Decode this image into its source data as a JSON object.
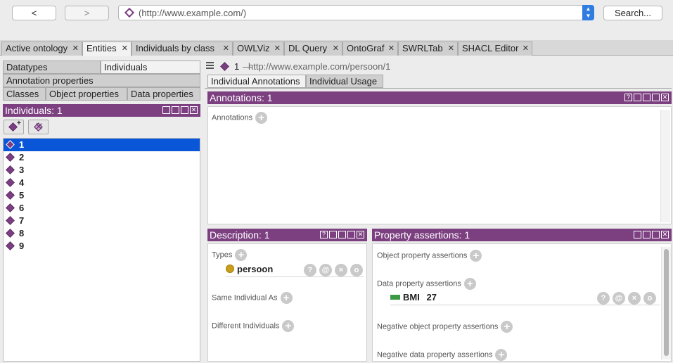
{
  "toolbar": {
    "back_label": "<",
    "forward_label": ">",
    "address_value": "(http://www.example.com/)",
    "search_label": "Search..."
  },
  "workspace_tabs": [
    {
      "label": "Active ontology"
    },
    {
      "label": "Entities"
    },
    {
      "label": "Individuals by class"
    },
    {
      "label": "OWLViz"
    },
    {
      "label": "DL Query"
    },
    {
      "label": "OntoGraf"
    },
    {
      "label": "SWRLTab"
    },
    {
      "label": "SHACL Editor"
    }
  ],
  "entity_tabs": {
    "datatypes": "Datatypes",
    "individuals": "Individuals",
    "annotation_properties": "Annotation properties",
    "classes": "Classes",
    "object_properties": "Object properties",
    "data_properties": "Data properties"
  },
  "individuals_panel": {
    "title": "Individuals: 1",
    "items": [
      "1",
      "2",
      "3",
      "4",
      "5",
      "6",
      "7",
      "8",
      "9"
    ],
    "selected": "1"
  },
  "breadcrumb": {
    "name": "1",
    "separator": "—",
    "iri": "http://www.example.com/persoon/1"
  },
  "right_tabs": {
    "individual_annotations": "Individual Annotations",
    "individual_usage": "Individual Usage"
  },
  "annotations_panel": {
    "title": "Annotations: 1",
    "section": "Annotations"
  },
  "description_panel": {
    "title": "Description: 1",
    "types_label": "Types",
    "type_value": "persoon",
    "same_individual_label": "Same Individual As",
    "different_individuals_label": "Different Individuals"
  },
  "property_panel": {
    "title": "Property assertions: 1",
    "object_label": "Object property assertions",
    "data_label": "Data property assertions",
    "data_property": "BMI",
    "data_value": "27",
    "neg_object_label": "Negative object property assertions",
    "neg_data_label": "Negative data property assertions"
  },
  "icons": {
    "help": "?",
    "annotate": "@",
    "delete": "×",
    "edit": "o",
    "close": "x"
  },
  "colors": {
    "view_header": "#7c4081",
    "selection": "#0a56d8",
    "individual_icon": "#7b3e83",
    "class_icon": "#c99e1a",
    "data_property_icon": "#3c9a44"
  }
}
